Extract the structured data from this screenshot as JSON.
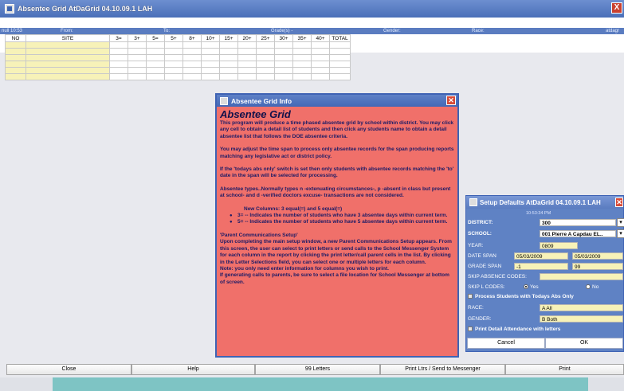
{
  "window": {
    "title": "Absentee Grid  AtDaGrid 04.10.09.1 LAH",
    "close": "X"
  },
  "header_labels": {
    "left": "null   10:53",
    "from": "From:",
    "to": "To:",
    "grades": "Grade(s) -",
    "gender": "Gender:",
    "race": "Race:",
    "right": "atdagr"
  },
  "grid": {
    "columns": [
      "NO",
      "SITE",
      "3=",
      "3+",
      "5=",
      "5+",
      "8+",
      "10+",
      "15+",
      "20+",
      "25+",
      "30+",
      "35+",
      "40+",
      "TOTAL"
    ],
    "rows": 6
  },
  "info_dialog": {
    "title": "Absentee Grid Info",
    "heading": "Absentee Grid",
    "paragraphs": {
      "p1": "This program will produce a time phased absentee grid by school within district. You may click any cell to obtain a detail list of students and then click any students name to obtain a detail absentee list that follows the DOE absentee criteria.",
      "p2": "You may adjust the time span to process only absentee records for the span producing reports matching any legislative act or district policy.",
      "p3": "If the 'todays abs only' switch is set then only students with absentee records matching the 'to' date in the span will be selected for processing.",
      "p4": "Absentee types..Normally types n -extenuating circumstances-, p -absent in class but present at school- and d -verified doctors excuse- transactions are not considered.",
      "new_cols": "New Columns: 3 equal(=) and 5 equal(=)",
      "bullet1": "3= -- Indicates the number of students who have 3 absentee days within current term.",
      "bullet2": "5= -- Indicates the number of students who have 5 absentee days within current term.",
      "p5_title": "'Parent Communications Setup'",
      "p5": "Upon completing the main setup window, a new Parent Communications Setup appears. From this screen, the user can select to print letters or send calls to the School Messenger System for each column in the report by clicking the print letter/call parent cells in the list. By clicking in the Letter Selections field, you can select one or multiple letters for each column.",
      "p6": "Note: you only need enter information for columns you wish to print.",
      "p7": "If generating calls to parents, be sure to select a file location for School Messenger at bottom of screen."
    }
  },
  "setup_dialog": {
    "title": "Setup Defaults  AtDaGrid 04.10.09.1 LAH",
    "time": "10:53:34 PM",
    "district_label": "DISTRICT:",
    "district_value": "300",
    "school_label": "SCHOOL:",
    "school_value": "001 Pierre A Capdau EL..",
    "year_label": "YEAR:",
    "year_value": "0809",
    "date_span_label": "DATE SPAN",
    "date_from": "05/03/2009",
    "date_to": "05/03/2009",
    "grade_span_label": "GRADE SPAN",
    "grade_from": "-1",
    "grade_to": "99",
    "skip_abs_label": "SKIP ABSENCE CODES:",
    "skip_abs_value": "",
    "skip_l_label": "SKIP L CODES:",
    "yes_label": "Yes",
    "no_label": "No",
    "todays_abs_label": "Process Students with Todays Abs Only",
    "race_label": "RACE:",
    "race_value": "A All",
    "gender_label": "GENDER:",
    "gender_value": "B Both",
    "print_detail_label": "Print Detail Attendance with letters",
    "cancel": "Cancel",
    "ok": "OK"
  },
  "bottom_buttons": {
    "close": "Close",
    "help": "Help",
    "letters": "99 Letters",
    "print_ltrs": "Print Ltrs / Send to Messenger",
    "print": "Print"
  },
  "colors": {
    "title_blue": "#4a6fb8",
    "info_red": "#f0706a",
    "setup_blue": "#5f82c4",
    "field_yellow": "#f7f2b8"
  }
}
